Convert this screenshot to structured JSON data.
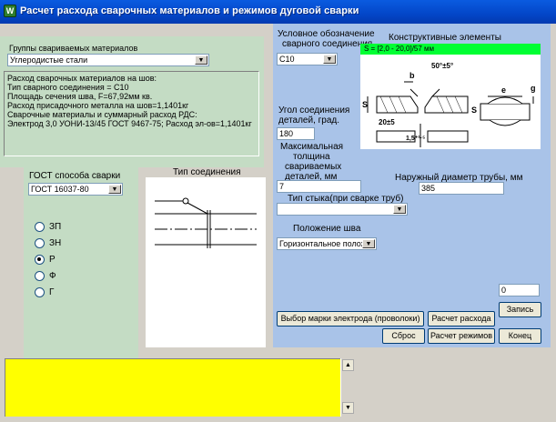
{
  "window": {
    "title": "Расчет расхода сварочных материалов и  режимов дуговой сварки",
    "icon_label": "W"
  },
  "left": {
    "group_label": "Группы свариваемых материалов",
    "group_value": "Углеродистые стали",
    "result_lines": [
      "Расход сварочных материалов на шов:",
      "Тип сварного соединения = С10",
      "Площадь сечения шва,  F=67,92мм кв.",
      "   Расход присадочного металла на шов=1,1401кг",
      "   Сварочные материалы и суммарный расход РДС:",
      "Электрод 3,0 УОНИ-13/45  ГОСТ 9467-75; Расход эл-ов=1,1401кг"
    ],
    "gost_label": "ГОСТ способа сварки",
    "gost_value": "ГОСТ 16037-80",
    "radios": [
      {
        "label": "ЗП",
        "selected": false
      },
      {
        "label": "ЗН",
        "selected": false
      },
      {
        "label": "Р",
        "selected": true
      },
      {
        "label": "Ф",
        "selected": false
      },
      {
        "label": "Г",
        "selected": false
      }
    ],
    "joint_type_label": "Тип соединения"
  },
  "right": {
    "designation_label_1": "Условное обозначение",
    "designation_label_2": "сварного соединения",
    "designation_value": "С10",
    "constructive_label": "Конструктивные элементы",
    "range_text": "S = [2,0 - 20,0]/57 мм",
    "drawing_labels": {
      "b": "b",
      "angle": "50°±5°",
      "s1": "S",
      "gap": "20±5",
      "tol": "1,5⁺¹·⁵",
      "s2": "S",
      "e": "e",
      "g": "g"
    },
    "angle_label_1": "Угол соединения",
    "angle_label_2": "деталей, град.",
    "angle_value": "180",
    "thickness_label_1": "Максимальная",
    "thickness_label_2": "толщина",
    "thickness_label_3": "свариваемых",
    "thickness_label_4": "деталей, мм",
    "thickness_value": "7",
    "diameter_label": "Наружный диаметр трубы, мм",
    "diameter_value": "385",
    "joint_label": "Тип стыка(при сварке труб)",
    "joint_value": "",
    "position_label": "Положение шва",
    "position_value": "Горизонтальное положе",
    "counter_value": "0"
  },
  "buttons": {
    "zapis": "Запись",
    "electrode": "Выбор марки электрода (проволоки)",
    "rashod": "Расчет расхода",
    "sbros": "Сброс",
    "rezhimov": "Расчет режимов",
    "konec": "Конец"
  },
  "colors": {
    "title_bar": "#0346c8",
    "green_panel": "#c4dcc4",
    "blue_panel": "#a9c3e8",
    "yellow_box": "#ffff00",
    "range_bar": "#00ff33"
  }
}
